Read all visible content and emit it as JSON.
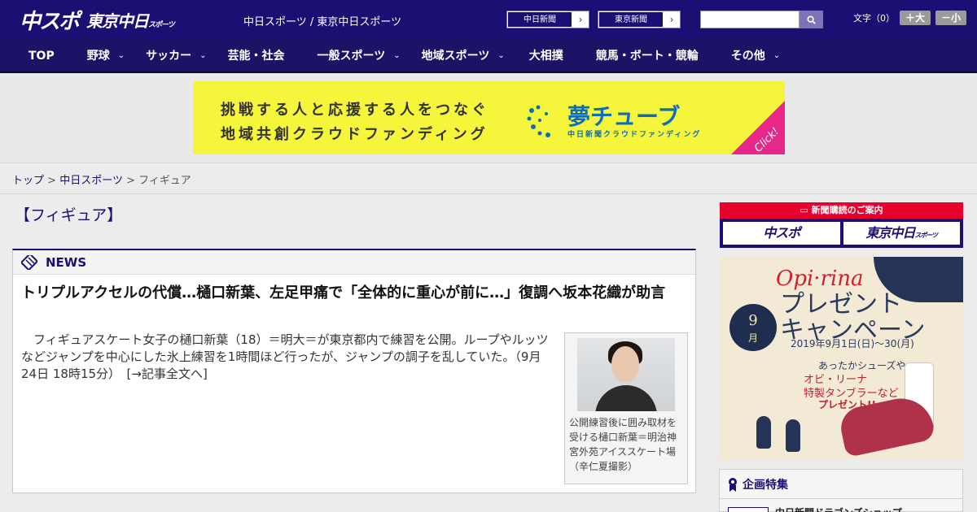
{
  "header": {
    "logo_chuspo": "中スポ",
    "logo_tokyo": "東京中日",
    "logo_tokyo_small": "スポーツ",
    "links": "中日スポーツ / 東京中日スポーツ",
    "site_buttons": [
      "中日新聞",
      "東京新聞"
    ],
    "search_placeholder": "",
    "font_label": "文字（0）",
    "font_larger": "＋大",
    "font_smaller": "－小"
  },
  "nav": {
    "items": [
      {
        "label": "TOP",
        "dropdown": false
      },
      {
        "label": "野球",
        "dropdown": true
      },
      {
        "label": "サッカー",
        "dropdown": true
      },
      {
        "label": "芸能・社会",
        "dropdown": false
      },
      {
        "label": "一般スポーツ",
        "dropdown": true
      },
      {
        "label": "地域スポーツ",
        "dropdown": true
      },
      {
        "label": "大相撲",
        "dropdown": false
      },
      {
        "label": "競馬・ボート・競輪",
        "dropdown": false
      },
      {
        "label": "その他",
        "dropdown": true
      }
    ]
  },
  "banner": {
    "line1": "挑戦する人と応援する人をつなぐ",
    "line2": "地域共創クラウドファンディング",
    "brand": "夢チューブ",
    "sub": "中日新聞クラウドファンディング",
    "click": "Click!"
  },
  "breadcrumb": {
    "items": [
      "トップ",
      "中日スポーツ"
    ],
    "current": "フィギュア",
    "sep": ">"
  },
  "page": {
    "title": "【フィギュア】"
  },
  "news": {
    "section": "NEWS",
    "headline": "トリプルアクセルの代償…樋口新葉、左足甲痛で「全体的に重心が前に…」復調へ坂本花織が助言",
    "body": "フィギュアスケート女子の樋口新葉（18）＝明大＝が東京都内で練習を公開。ループやルッツなどジャンプを中心にした氷上練習を1時間ほど行ったが、ジャンプの調子を乱していた。（9月24日 18時15分）",
    "more": "[→記事全文へ]",
    "caption": "公開練習後に囲み取材を受ける樋口新葉＝明治神宮外苑アイススケート場（辛仁夏撮影）"
  },
  "sidebar": {
    "subscribe_title": "新聞購読のご案内",
    "subscribe_chuspo": "中スポ",
    "subscribe_tokyo": "東京中日",
    "subscribe_tokyo_small": "スポーツ",
    "ad_brand": "Opi·rina",
    "ad_line1": "プレゼント",
    "ad_line2": "キャンペーン",
    "ad_month": "9",
    "ad_month_unit": "月",
    "ad_date": "2019年9月1日(日)〜30(月)",
    "ad_gift1": "あったかシューズや",
    "ad_gift2": "オビ・リーナ\n特製タンブラーなど",
    "ad_gift3": "プレゼント!!",
    "kikaku_title": "企画特集",
    "kikaku_item": "中日新聞ドラゴンズショップ"
  },
  "colors": {
    "header_bg": "#1b0f73",
    "nav_bg": "#1d1366",
    "banner_bg": "#f5f53b",
    "accent_red": "#e6002d",
    "link": "#1b0f73"
  }
}
